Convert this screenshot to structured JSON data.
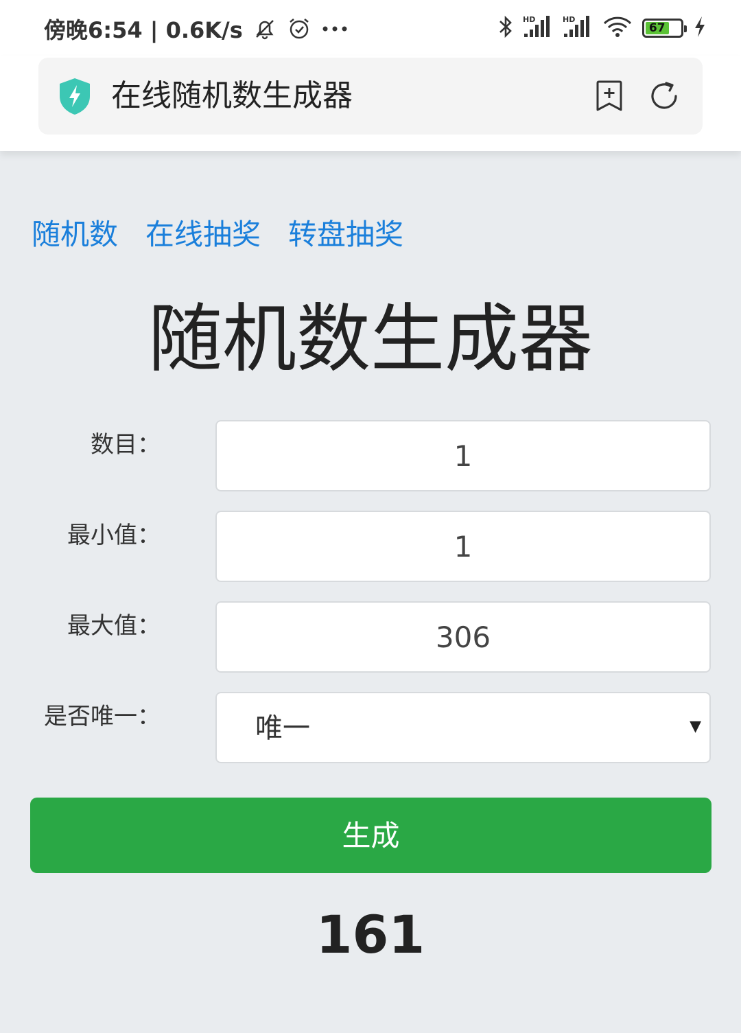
{
  "status_bar": {
    "time_speed": "傍晚6:54 | 0.6K/s",
    "battery": "67",
    "icons": [
      "mute-bell-icon",
      "alarm-icon",
      "more-dots-icon",
      "bluetooth-icon",
      "hd-signal-icon",
      "hd-signal-icon",
      "wifi-icon",
      "battery-icon",
      "charging-icon"
    ]
  },
  "browser": {
    "title": "在线随机数生成器",
    "icons": [
      "security-shield-icon",
      "add-bookmark-icon",
      "refresh-icon"
    ]
  },
  "nav": {
    "links": [
      "随机数",
      "在线抽奖",
      "转盘抽奖"
    ]
  },
  "page": {
    "title": "随机数生成器"
  },
  "form": {
    "count_label": "数目：",
    "count_value": "1",
    "min_label": "最小值：",
    "min_value": "1",
    "max_label": "最大值：",
    "max_value": "306",
    "unique_label": "是否唯一：",
    "unique_value": "唯一",
    "generate_label": "生成"
  },
  "result": {
    "value": "161"
  },
  "colors": {
    "link": "#1a7fdb",
    "button": "#2aa845",
    "background": "#e9ecef"
  }
}
